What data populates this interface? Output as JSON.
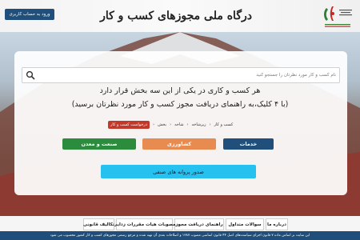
{
  "header": {
    "login_label": "ورود به حساب کاربری",
    "site_title": "درگاه ملی مجوزهای کسب و کار"
  },
  "search": {
    "placeholder": "نام کسب و کار مورد نظرتان را جستجو کنید"
  },
  "intro": {
    "line1": "هر کسب و کاری در یکی از این سه بخش قرار دارد",
    "line2": "(با ۴ کلیک،به راهنمای دریافت مجوز کسب و کار مورد نظرتان برسید)"
  },
  "breadcrumb": [
    "درخواست کسب و کار",
    "بخش",
    "شاخه",
    "زیرشاخه",
    "کسب و کار"
  ],
  "categories": {
    "services": "خدمات",
    "agriculture": "کشاورزی",
    "industry": "صنعت و معدن"
  },
  "permit_button": "صدور پروانه های صنفی",
  "footer_nav": {
    "about": "درباره ما",
    "faq": "سوالات متداول",
    "permit_guide": "راهنمای دریافت مجوز",
    "regulatory_boards": "مصوبات هیات مقررات زدایی",
    "legal_duties": "تکالیف قانونی"
  },
  "footer_note": "این سایت بر اساس ماده ۷ قانون اجرای سیاست‌های اصل ۴۴ قانون اساسی مصوب ۱۳۸۷ و اصلاحات بعدی آن تهیه شده و مرجع رسمی مجوزهای کسب و کار کشور محسوب می شود"
}
